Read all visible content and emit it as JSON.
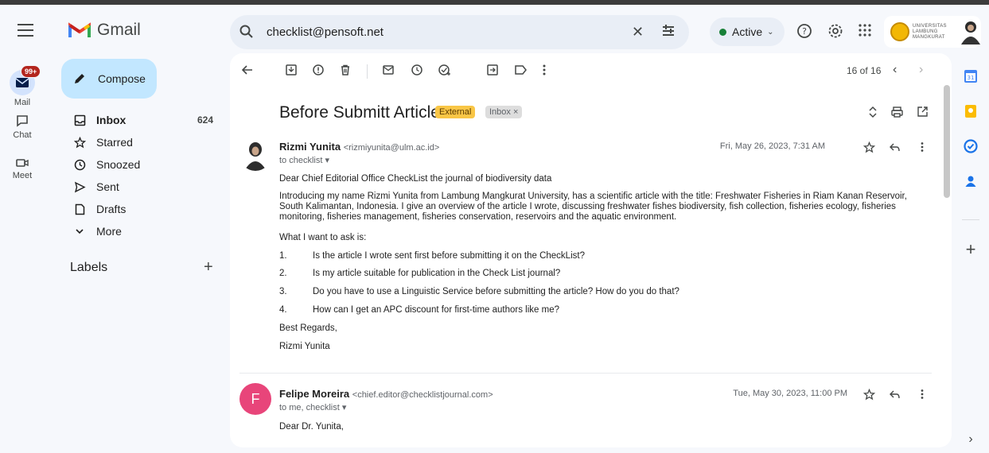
{
  "header": {
    "app_name": "Gmail",
    "search_value": "checklist@pensoft.net",
    "status_label": "Active",
    "account_org": "UNIVERSITAS LAMBUNG MANGKURAT"
  },
  "rail": {
    "mail_label": "Mail",
    "mail_badge": "99+",
    "chat_label": "Chat",
    "meet_label": "Meet"
  },
  "nav": {
    "compose_label": "Compose",
    "items": [
      {
        "label": "Inbox",
        "count": "624",
        "icon": "inbox-icon"
      },
      {
        "label": "Starred",
        "count": "",
        "icon": "star-icon"
      },
      {
        "label": "Snoozed",
        "count": "",
        "icon": "clock-icon"
      },
      {
        "label": "Sent",
        "count": "",
        "icon": "send-icon"
      },
      {
        "label": "Drafts",
        "count": "",
        "icon": "draft-icon"
      },
      {
        "label": "More",
        "count": "",
        "icon": "chevron-down-icon"
      }
    ],
    "labels_title": "Labels"
  },
  "toolbar": {
    "pager": "16 of 16"
  },
  "thread": {
    "subject": "Before Submitt Article",
    "tag_external": "External",
    "tag_inbox": "Inbox ×",
    "messages": [
      {
        "sender_name": "Rizmi Yunita",
        "sender_email": "<rizmiyunita@ulm.ac.id>",
        "to": "to checklist",
        "date": "Fri, May 26, 2023, 7:31 AM",
        "greeting": "Dear  Chief Editorial Office CheckList the journal of biodiversity data",
        "intro": "Introducing my name Rizmi Yunita from Lambung Mangkurat University, has a scientific article with the title: Freshwater Fisheries in Riam Kanan Reservoir, South Kalimantan, Indonesia. I give an overview of the article I wrote, discussing freshwater fishes biodiversity, fish collection, fisheries ecology, fisheries monitoring, fisheries management, fisheries conservation, reservoirs and the aquatic environment.",
        "question_lead": "What I want to ask is:",
        "questions": [
          {
            "num": "1.",
            "text": "Is the article I wrote sent first before submitting it on the CheckList?"
          },
          {
            "num": "2.",
            "text": "Is my article suitable for publication in the Check List journal?"
          },
          {
            "num": "3.",
            "text": "Do you have to use a Linguistic Service before submitting the article? How do you do that?"
          },
          {
            "num": "4.",
            "text": "How can I get an APC discount for first-time authors like me?"
          }
        ],
        "closing": "Best Regards,",
        "signature": "Rizmi Yunita"
      },
      {
        "avatar_letter": "F",
        "sender_name": "Felipe Moreira",
        "sender_email": "<chief.editor@checklistjournal.com>",
        "to": "to me, checklist",
        "date": "Tue, May 30, 2023, 11:00 PM",
        "greeting": "Dear Dr. Yunita,"
      }
    ]
  },
  "colors": {
    "compose_bg": "#c2e7ff",
    "external_tag": "#f9c646",
    "avatar_f": "#e8457a",
    "status_dot": "#188038",
    "badge": "#b3261e"
  }
}
